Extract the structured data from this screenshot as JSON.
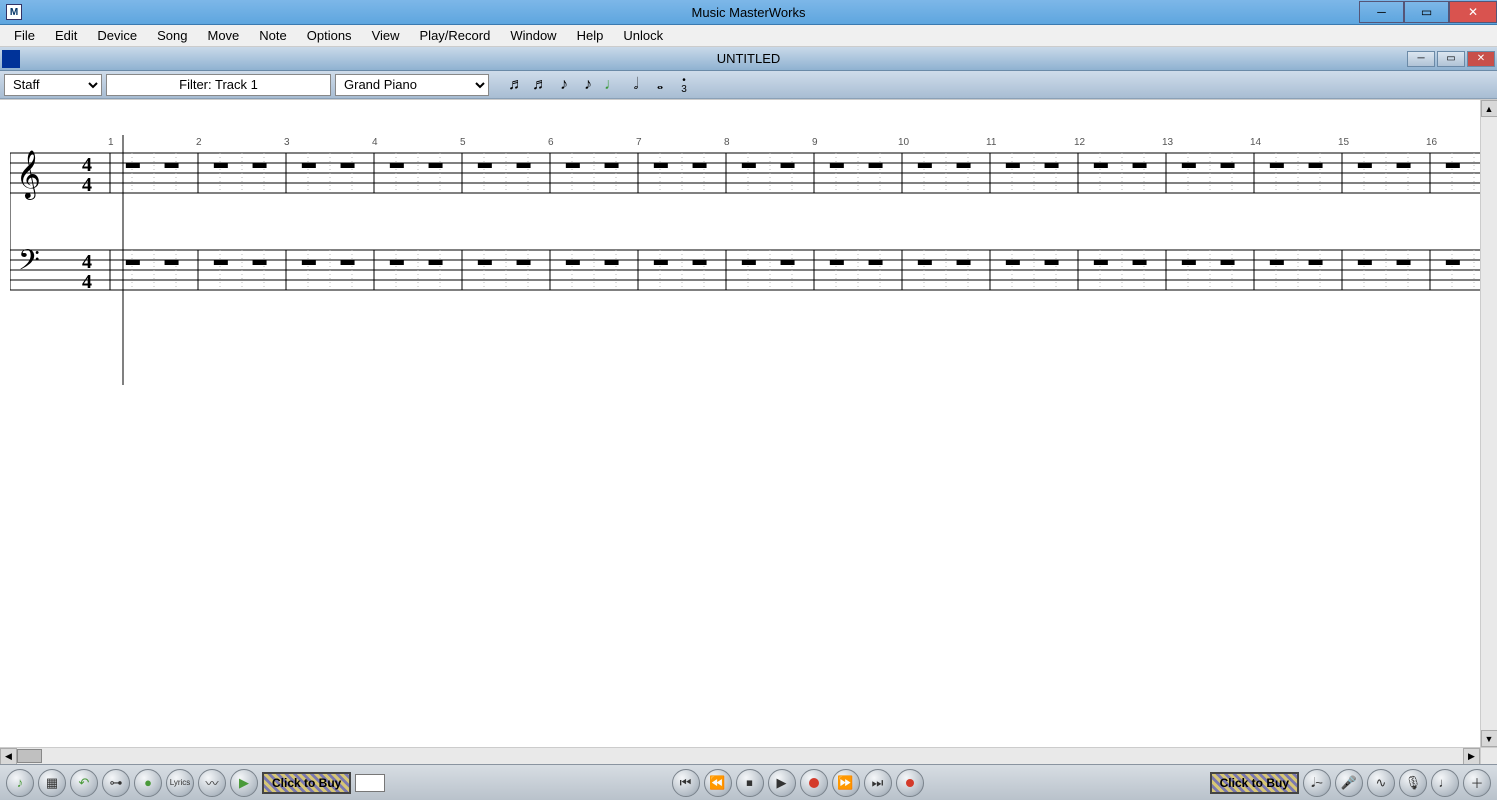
{
  "titlebar": {
    "title": "Music MasterWorks"
  },
  "menu": [
    "File",
    "Edit",
    "Device",
    "Song",
    "Move",
    "Note",
    "Options",
    "View",
    "Play/Record",
    "Window",
    "Help",
    "Unlock"
  ],
  "docbar": {
    "title": "UNTITLED"
  },
  "toolbar": {
    "view_select": "Staff",
    "filter_label": "Filter: Track 1",
    "instrument_select": "Grand Piano"
  },
  "note_tools": {
    "items": [
      "thirtysecond-note",
      "sixteenth-note",
      "eighth-note-1",
      "eighth-note-2",
      "quarter-note-green",
      "half-note",
      "whole-note",
      "triplet"
    ]
  },
  "score": {
    "time_signature": {
      "top": "4",
      "bottom": "4"
    },
    "measures": 16,
    "measure_numbers": [
      1,
      2,
      3,
      4,
      5,
      6,
      7,
      8,
      9,
      10,
      11,
      12,
      13,
      14,
      15,
      16
    ]
  },
  "bottom": {
    "left_tools": [
      "note-tool",
      "grid-tool",
      "undo-tool",
      "link-tool",
      "dot-tool",
      "lyrics-tool",
      "wave-tool",
      "play-green-tool"
    ],
    "buy_label": "Click to Buy",
    "transport": [
      "skip-start",
      "rewind",
      "stop",
      "play",
      "record",
      "fast-forward",
      "skip-end",
      "record-loop"
    ],
    "right_buy_label": "Click to Buy",
    "right_tools": [
      "tempo-tool",
      "mic-tool",
      "tune-tool",
      "mic2-tool",
      "metronome-tool",
      "add-tool"
    ]
  }
}
